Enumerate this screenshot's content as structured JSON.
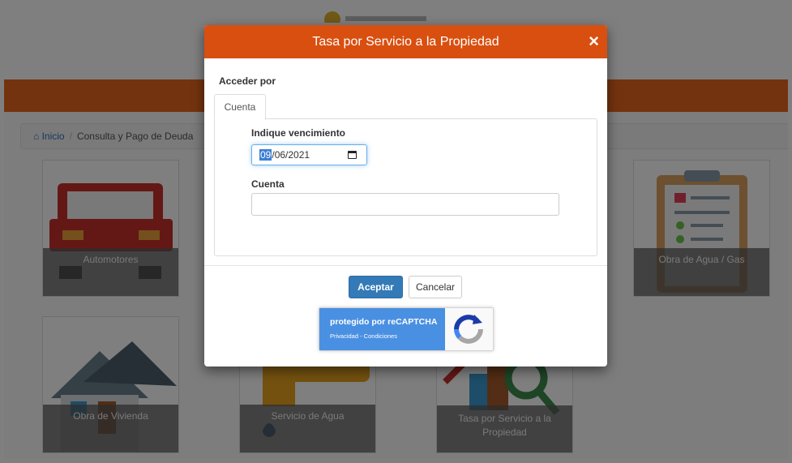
{
  "breadcrumb": {
    "home_icon": "home-icon",
    "home": "Inicio",
    "separator": "/",
    "current": "Consulta y Pago de Deuda"
  },
  "tiles": {
    "automotores": "Automotores",
    "obra_agua_gas": "Obra de Agua / Gas",
    "obra_vivienda": "Obra de Vivienda",
    "servicio_agua": "Servicio de Agua",
    "tasa_line1": "Tasa por Servicio a la",
    "tasa_line2": "Propiedad"
  },
  "modal": {
    "title": "Tasa por Servicio a la Propiedad",
    "close": "×",
    "access_label": "Acceder por",
    "tab": "Cuenta",
    "due_label": "Indique vencimiento",
    "date_day": "09",
    "date_rest": "/06/2021",
    "account_label": "Cuenta",
    "account_value": "",
    "accept": "Aceptar",
    "cancel": "Cancelar"
  },
  "recaptcha": {
    "line1": "protegido por reCAPTCHA",
    "line2": "Privacidad - Condiciones"
  },
  "colors": {
    "header_orange": "#d94f10",
    "banner_orange": "#e8671f",
    "primary": "#337ab7",
    "recaptcha_blue": "#4a90e2"
  }
}
